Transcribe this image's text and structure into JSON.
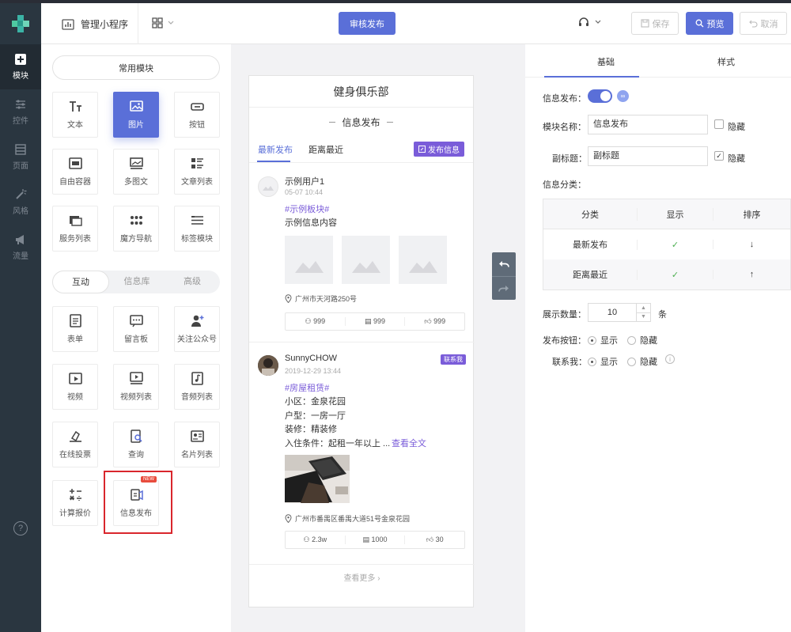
{
  "topbar": {
    "manage_label": "管理小程序",
    "publish_label": "审核发布",
    "save_label": "保存",
    "preview_label": "预览",
    "cancel_label": "取消"
  },
  "leftnav": {
    "items": [
      {
        "label": "模块",
        "icon": "plus-square-icon",
        "active": true
      },
      {
        "label": "控件",
        "icon": "sliders-icon"
      },
      {
        "label": "页面",
        "icon": "layout-icon"
      },
      {
        "label": "风格",
        "icon": "magic-wand-icon"
      },
      {
        "label": "流量",
        "icon": "megaphone-icon"
      }
    ],
    "help": "?"
  },
  "components": {
    "common_title": "常用模块",
    "common": [
      {
        "label": "文本",
        "icon": "text-icon"
      },
      {
        "label": "图片",
        "icon": "image-icon",
        "selected": true
      },
      {
        "label": "按钮",
        "icon": "button-icon"
      },
      {
        "label": "自由容器",
        "icon": "container-icon"
      },
      {
        "label": "多图文",
        "icon": "multi-image-icon"
      },
      {
        "label": "文章列表",
        "icon": "article-list-icon"
      },
      {
        "label": "服务列表",
        "icon": "service-list-icon"
      },
      {
        "label": "魔方导航",
        "icon": "grid-nav-icon"
      },
      {
        "label": "标签模块",
        "icon": "tag-icon"
      }
    ],
    "tabs": [
      "互动",
      "信息库",
      "高级"
    ],
    "interactive": [
      {
        "label": "表单",
        "icon": "form-icon"
      },
      {
        "label": "留言板",
        "icon": "message-icon"
      },
      {
        "label": "关注公众号",
        "icon": "follow-icon"
      },
      {
        "label": "视频",
        "icon": "video-icon"
      },
      {
        "label": "视频列表",
        "icon": "video-list-icon"
      },
      {
        "label": "音频列表",
        "icon": "audio-icon"
      },
      {
        "label": "在线投票",
        "icon": "vote-icon"
      },
      {
        "label": "查询",
        "icon": "query-icon"
      },
      {
        "label": "名片列表",
        "icon": "card-icon"
      },
      {
        "label": "计算报价",
        "icon": "calc-icon"
      },
      {
        "label": "信息发布",
        "icon": "publish-icon",
        "badge": "NEW"
      }
    ]
  },
  "phone": {
    "title": "健身俱乐部",
    "subtitle": "信息发布",
    "tabs": [
      "最新发布",
      "距离最近"
    ],
    "post_button": "发布信息",
    "posts": [
      {
        "user": "示例用户1",
        "date": "05-07 10:44",
        "tag": "#示例板块#",
        "lines": [
          "示例信息内容"
        ],
        "address": "广州市天河路250号",
        "stats": [
          "999",
          "999",
          "999"
        ]
      },
      {
        "user": "SunnyCHOW",
        "date": "2019-12-29 13:44",
        "contact": "联系我",
        "tag": "#房屋租赁#",
        "lines": [
          "小区：金泉花园",
          "户型：一房一厅",
          "装修：精装修",
          "入住条件：起租一年以上 ..."
        ],
        "read_more": "查看全文",
        "address": "广州市番禺区番禺大道51号金泉花园",
        "stats": [
          "2.3w",
          "1000",
          "30"
        ]
      }
    ],
    "more": "查看更多"
  },
  "props": {
    "tabs": [
      "基础",
      "样式"
    ],
    "publish_label": "信息发布：",
    "name_label": "模块名称：",
    "name_value": "信息发布",
    "hide_label": "隐藏",
    "subtitle_label": "副标题：",
    "subtitle_value": "副标题",
    "category_label": "信息分类：",
    "table_headers": [
      "分类",
      "显示",
      "排序"
    ],
    "table_rows": [
      {
        "name": "最新发布",
        "show": "✓",
        "sort": "↓"
      },
      {
        "name": "距离最近",
        "show": "✓",
        "sort": "↑"
      }
    ],
    "count_label": "展示数量：",
    "count_value": "10",
    "count_unit": "条",
    "button_label": "发布按钮：",
    "contact_label": "联系我：",
    "show": "显示",
    "hide": "隐藏"
  },
  "colors": {
    "accent": "#5a6fd8",
    "purple": "#7a5cd9",
    "nav_bg": "#2a3640"
  }
}
